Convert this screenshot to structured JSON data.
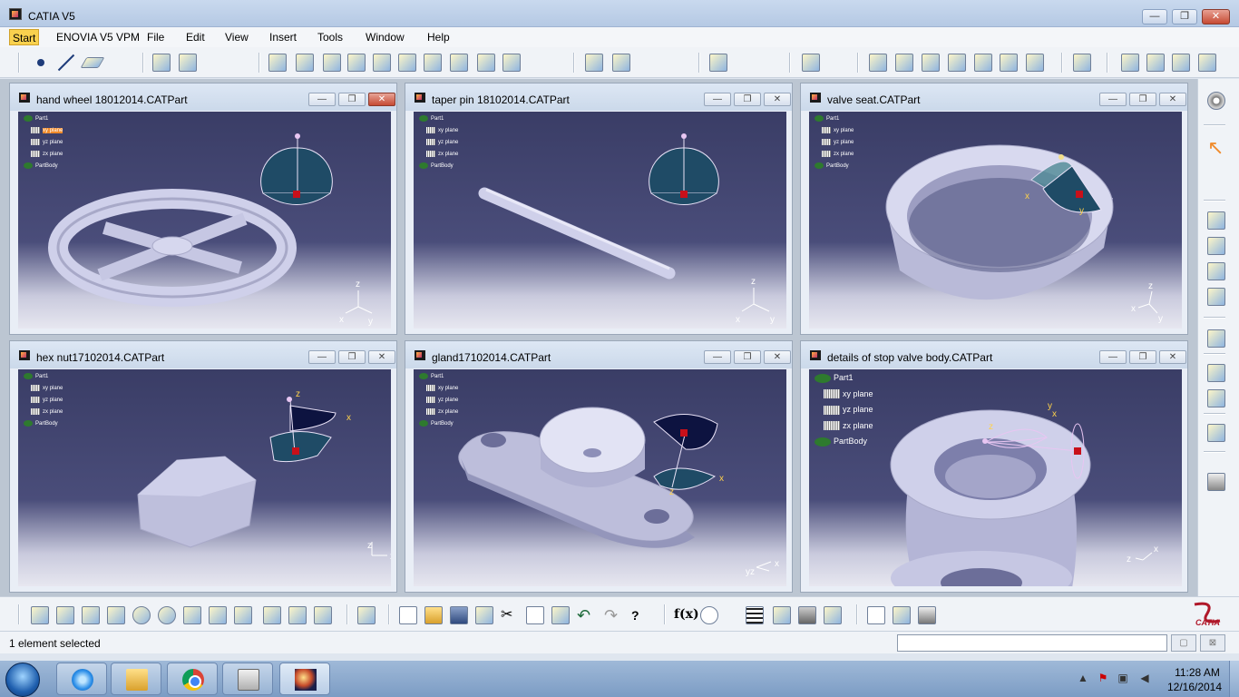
{
  "app": {
    "title": "CATIA V5"
  },
  "window_buttons": {
    "minimize": "—",
    "maximize": "❐",
    "close": "✕"
  },
  "menu": [
    {
      "label": "Start"
    },
    {
      "label": "ENOVIA V5 VPM"
    },
    {
      "label": "File"
    },
    {
      "label": "Edit"
    },
    {
      "label": "View"
    },
    {
      "label": "Insert"
    },
    {
      "label": "Tools"
    },
    {
      "label": "Window"
    },
    {
      "label": "Help"
    }
  ],
  "windows": [
    {
      "title": "hand wheel 18012014.CATPart",
      "tree": [
        "Part1",
        "xy plane",
        "yz plane",
        "zx plane",
        "PartBody"
      ],
      "axis": [
        "x",
        "y",
        "z"
      ]
    },
    {
      "title": "taper pin 18102014.CATPart",
      "tree": [
        "Part1",
        "xy plane",
        "yz plane",
        "zx plane",
        "PartBody"
      ],
      "axis": [
        "x",
        "y",
        "z"
      ]
    },
    {
      "title": "valve seat.CATPart",
      "tree": [
        "Part1",
        "xy plane",
        "yz plane",
        "zx plane",
        "PartBody"
      ],
      "axis": [
        "x",
        "y",
        "z"
      ]
    },
    {
      "title": "hex nut17102014.CATPart",
      "tree": [
        "Part1",
        "xy plane",
        "yz plane",
        "zx plane",
        "PartBody"
      ],
      "axis": [
        "x",
        "z"
      ]
    },
    {
      "title": "gland17102014.CATPart",
      "tree": [
        "Part1",
        "xy plane",
        "yz plane",
        "zx plane",
        "PartBody"
      ],
      "axis": [
        "x",
        "yz"
      ]
    },
    {
      "title": "details of stop valve body.CATPart",
      "tree": [
        "Part1",
        "xy plane",
        "yz plane",
        "zx plane",
        "PartBody"
      ],
      "axis": [
        "x",
        "z"
      ]
    }
  ],
  "compass_labels": {
    "x": "x",
    "y": "y",
    "z": "z"
  },
  "bottom_toolbar": {
    "formula_label": "f(x)"
  },
  "logo": {
    "text": "CATIA"
  },
  "status": {
    "text": "1 element selected",
    "power_input": ""
  },
  "taskbar": {
    "time": "11:28 AM",
    "date": "12/16/2014"
  },
  "icons": {
    "top_toolbar": [
      "point-icon",
      "line-icon",
      "plane-icon",
      "sketch-icon",
      "pad-icon",
      "pocket-icon",
      "shaft-icon",
      "groove-icon",
      "hole-icon",
      "rib-icon",
      "slot-icon",
      "stiffener-icon",
      "loft-icon",
      "fillet-icon",
      "chamfer-icon",
      "draft-icon",
      "shell-icon",
      "thickness-icon",
      "thread-icon",
      "translate-icon",
      "mirror-icon",
      "pattern-icon",
      "scale-icon",
      "apply-material-icon",
      "measure-icon",
      "analysis-icon"
    ],
    "right_toolbar": [
      "settings-icon",
      "select-cursor-icon",
      "boolean-icon",
      "assemble-icon",
      "add-icon",
      "remove-icon",
      "axis-system-icon",
      "annotation-icon",
      "pattern-icon",
      "compass-icon",
      "capture-icon"
    ],
    "bottom_toolbar": [
      "fly-mode-icon",
      "fit-all-icon",
      "pan-icon",
      "rotate-icon",
      "zoom-in-icon",
      "zoom-out-icon",
      "normal-view-icon",
      "multi-view-icon",
      "iso-view-icon",
      "shading-icon",
      "hide-show-icon",
      "swap-space-icon",
      "update-icon",
      "new-icon",
      "open-icon",
      "save-icon",
      "print-icon",
      "cut-icon",
      "copy-icon",
      "paste-icon",
      "undo-icon",
      "redo-icon",
      "whats-this-icon",
      "formula-icon",
      "comment-icon",
      "table-icon",
      "knowledge-icon",
      "lock-icon",
      "ruler-icon",
      "catalog-icon",
      "tool-icon"
    ]
  },
  "colors": {
    "viewport_top": "#3a3d66",
    "viewport_bottom": "#e7e7f0",
    "selection": "#f9d14e",
    "compass": "#1f4b66"
  }
}
